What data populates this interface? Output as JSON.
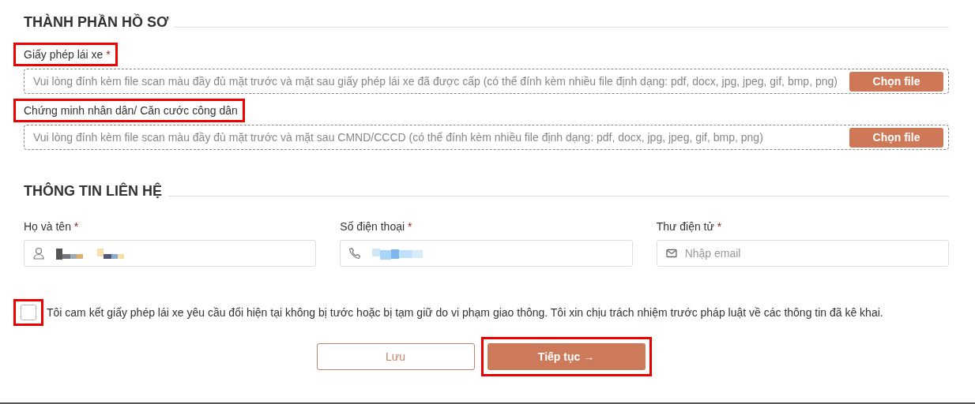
{
  "sections": [
    {
      "kind": "documents",
      "title": "THÀNH PHẦN HỒ SƠ",
      "items": [
        {
          "label": "Giấy phép lái xe",
          "asterisk": "*",
          "highlighted": true,
          "placeholder": "Vui lòng đính kèm file scan màu đầy đủ mặt trước và mặt sau giấy phép lái xe đã được cấp (có thể đính kèm nhiều file định dạng: pdf, docx, jpg, jpeg, gif, bmp, png)",
          "button": "Chọn file"
        },
        {
          "label": "Chứng minh nhân dân/ Căn cước công dân",
          "highlighted": true,
          "placeholder": "Vui lòng đính kèm file scan màu đầy đủ mặt trước và mặt sau CMND/CCCD (có thể đính kèm nhiều file định dạng: pdf, docx, jpg, jpeg, gif, bmp, png)",
          "button": "Chọn file"
        }
      ]
    },
    {
      "kind": "contact",
      "title": "THÔNG TIN LIÊN HỆ",
      "fields": [
        {
          "kind": "name",
          "label": "Họ và tên",
          "asterisk": "*",
          "redacted": true
        },
        {
          "kind": "phone",
          "label": "Số điện thoại",
          "asterisk": "*",
          "redacted": true
        },
        {
          "kind": "email",
          "label": "Thư điện tử",
          "asterisk": "*",
          "placeholder": "Nhập email"
        }
      ]
    }
  ],
  "agreement": {
    "checked": false,
    "highlighted": true,
    "text": "Tôi cam kết giấy phép lái xe yêu cầu đổi hiện tại không bị tước hoặc bị tạm giữ do vi phạm giao thông. Tôi xin chịu trách nhiệm trước pháp luật về các thông tin đã kê khai."
  },
  "buttons": [
    {
      "kind": "outline",
      "label": "Lưu",
      "highlighted": false
    },
    {
      "kind": "primary",
      "label": "Tiếp tục →",
      "highlighted": true
    }
  ]
}
